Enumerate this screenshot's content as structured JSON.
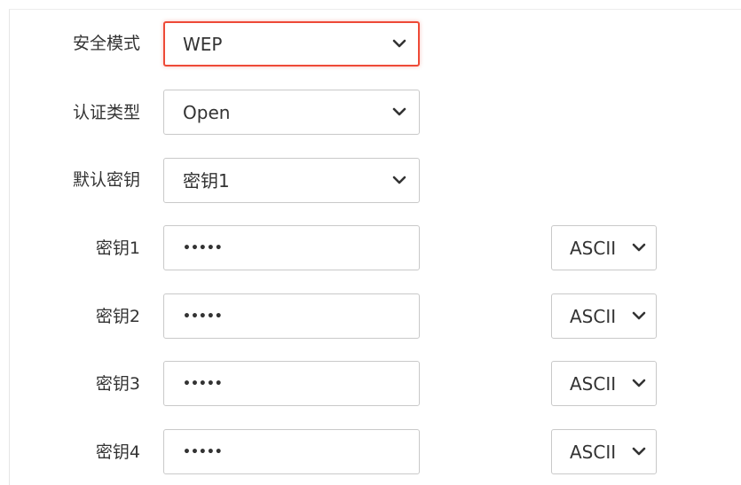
{
  "form": {
    "security_mode": {
      "label": "安全模式",
      "value": "WEP"
    },
    "auth_type": {
      "label": "认证类型",
      "value": "Open"
    },
    "default_key": {
      "label": "默认密钥",
      "value": "密钥1"
    },
    "keys": [
      {
        "label": "密钥1",
        "value": "•••••",
        "encoding": "ASCII"
      },
      {
        "label": "密钥2",
        "value": "•••••",
        "encoding": "ASCII"
      },
      {
        "label": "密钥3",
        "value": "•••••",
        "encoding": "ASCII"
      },
      {
        "label": "密钥4",
        "value": "•••••",
        "encoding": "ASCII"
      }
    ]
  },
  "colors": {
    "focus_border": "#ee4a37",
    "field_border": "#c9c9c9",
    "text": "#333333"
  },
  "icons": {
    "dropdown": "chevron-down-icon"
  }
}
